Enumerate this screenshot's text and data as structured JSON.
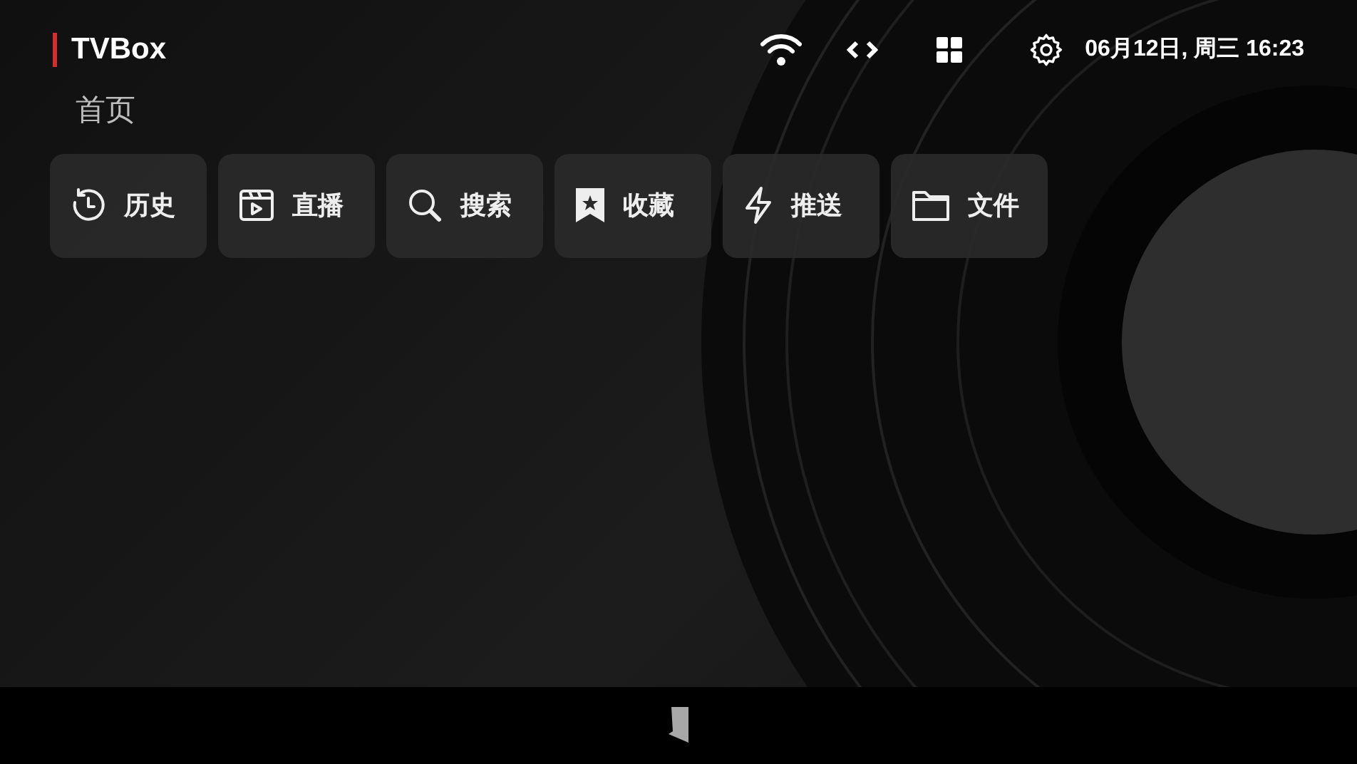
{
  "app": {
    "title": "TVBox"
  },
  "page_title": "首页",
  "status": {
    "datetime": "06月12日, 周三 16:23"
  },
  "quick_actions": [
    {
      "kind": "history",
      "label": "历史"
    },
    {
      "kind": "live",
      "label": "直播"
    },
    {
      "kind": "search",
      "label": "搜索"
    },
    {
      "kind": "favorites",
      "label": "收藏"
    },
    {
      "kind": "push",
      "label": "推送"
    },
    {
      "kind": "files",
      "label": "文件"
    }
  ]
}
